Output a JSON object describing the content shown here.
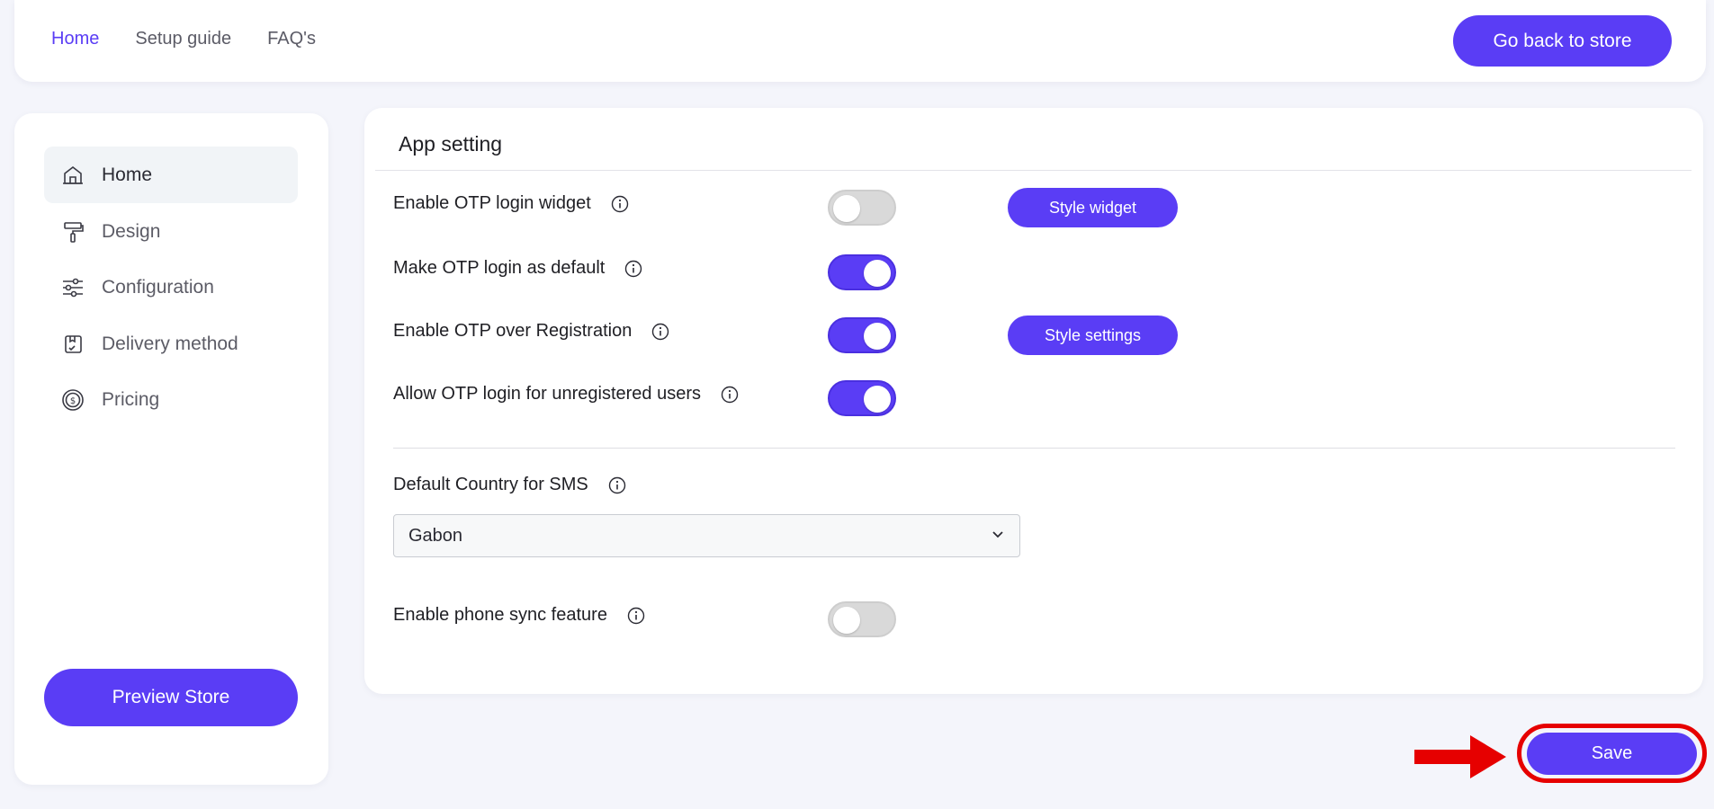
{
  "topnav": {
    "items": [
      "Home",
      "Setup guide",
      "FAQ's"
    ],
    "active": "Home",
    "back_button": "Go back to store"
  },
  "sidebar": {
    "items": [
      {
        "label": "Home",
        "icon": "home-icon",
        "active": true
      },
      {
        "label": "Design",
        "icon": "paint-roller-icon",
        "active": false
      },
      {
        "label": "Configuration",
        "icon": "sliders-icon",
        "active": false
      },
      {
        "label": "Delivery method",
        "icon": "delivery-box-icon",
        "active": false
      },
      {
        "label": "Pricing",
        "icon": "dollar-coin-icon",
        "active": false
      }
    ],
    "preview_button": "Preview Store"
  },
  "panel": {
    "title": "App setting",
    "settings": [
      {
        "label": "Enable OTP login widget",
        "enabled": false,
        "button": "Style widget"
      },
      {
        "label": "Make OTP login as default",
        "enabled": true
      },
      {
        "label": "Enable OTP over Registration",
        "enabled": true,
        "button": "Style settings"
      },
      {
        "label": "Allow OTP login for unregistered users",
        "enabled": true
      }
    ],
    "country": {
      "label": "Default Country for SMS",
      "selected": "Gabon"
    },
    "phone_sync": {
      "label": "Enable phone sync feature",
      "enabled": false
    }
  },
  "save_button": "Save",
  "colors": {
    "accent": "#5a3df5",
    "highlight": "#e60000",
    "background": "#f4f5fb"
  }
}
